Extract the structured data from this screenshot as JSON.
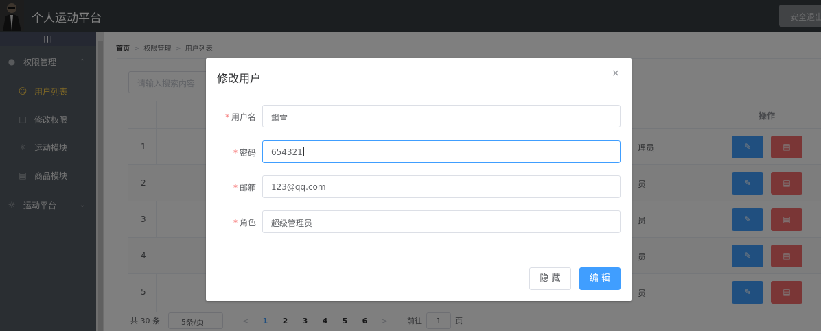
{
  "header": {
    "title": "个人运动平台",
    "logout_label": "安全退出"
  },
  "sidebar": {
    "collapse_label": "|||",
    "items": [
      {
        "label": "权限管理",
        "icon": "user-icon",
        "expandable": true
      },
      {
        "label": "用户列表",
        "icon": "person-icon",
        "active": true
      },
      {
        "label": "修改权限",
        "icon": "lock-icon"
      },
      {
        "label": "运动模块",
        "icon": "sun-icon"
      },
      {
        "label": "商品模块",
        "icon": "bag-icon"
      },
      {
        "label": "运动平台",
        "icon": "sun-icon",
        "expandable": true
      }
    ]
  },
  "breadcrumb": {
    "home": "首页",
    "level1": "权限管理",
    "level2": "用户列表"
  },
  "search": {
    "placeholder": "请输入搜索内容"
  },
  "table": {
    "op_header": "操作",
    "rows": [
      {
        "index": "1",
        "role_tail": "理员"
      },
      {
        "index": "2",
        "role_tail": "员"
      },
      {
        "index": "3",
        "role_tail": "员"
      },
      {
        "index": "4",
        "role_tail": "员"
      },
      {
        "index": "5",
        "role_tail": "员"
      }
    ]
  },
  "pagination": {
    "total": "共 30 条",
    "page_size": "5条/页",
    "prev": "<",
    "pages": [
      "1",
      "2",
      "3",
      "4",
      "5",
      "6"
    ],
    "current": "1",
    "next": ">",
    "goto_label": "前往",
    "goto_value": "1",
    "goto_unit": "页"
  },
  "dialog": {
    "title": "修改用户",
    "close": "×",
    "fields": [
      {
        "label": "用户名",
        "value": "飘雪"
      },
      {
        "label": "密码",
        "value": "654321",
        "focused": true
      },
      {
        "label": "邮箱",
        "value": "123@qq.com"
      },
      {
        "label": "角色",
        "value": "超级管理员"
      }
    ],
    "cancel_label": "隐 藏",
    "confirm_label": "编 辑"
  },
  "colors": {
    "primary": "#409eff",
    "danger": "#f56c6c",
    "sidebar_bg": "#545c64",
    "active_menu": "#ffd04b",
    "header_bg": "#373d41"
  }
}
